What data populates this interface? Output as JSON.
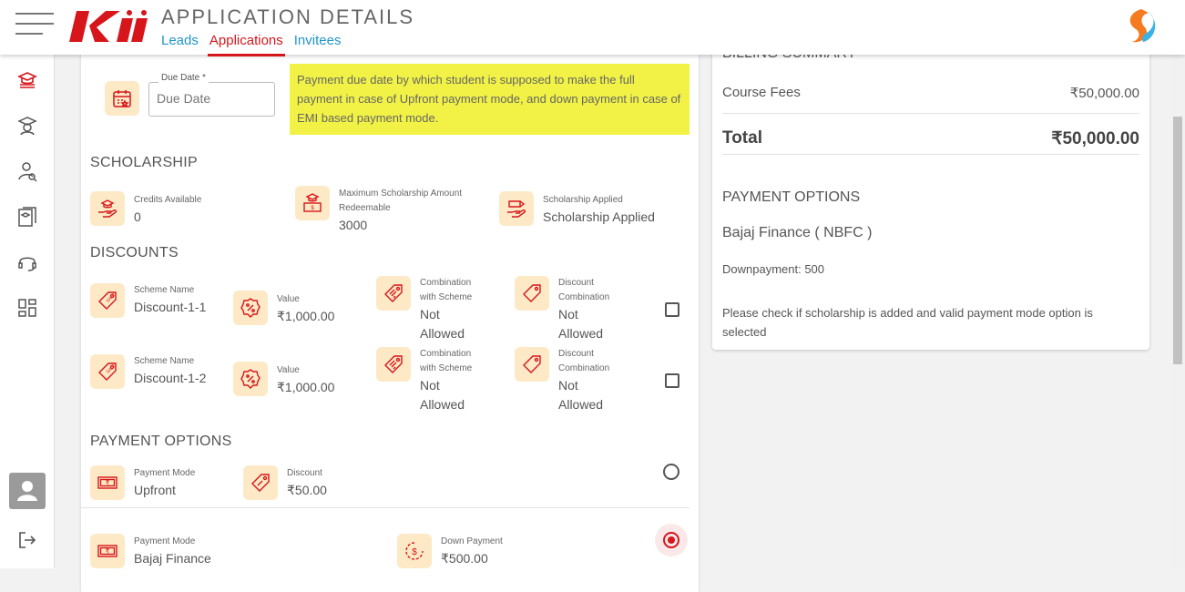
{
  "header": {
    "title": "APPLICATION DETAILS",
    "tabs": [
      {
        "label": "Leads",
        "active": false
      },
      {
        "label": "Applications",
        "active": true
      },
      {
        "label": "Invitees",
        "active": false
      }
    ],
    "logo_text": "Kii"
  },
  "sidebar": {
    "icons": [
      "graduation-stack-icon",
      "graduation-cap-user-icon",
      "user-search-icon",
      "courses-icon",
      "headset-icon",
      "dashboard-grid-icon"
    ],
    "bottom": [
      "avatar",
      "logout-icon"
    ]
  },
  "due_date": {
    "label": "Due Date *",
    "placeholder": "Due Date",
    "note": "Payment due date by which student is supposed to make the full payment in case of Upfront payment mode, and down payment in case of EMI based payment mode."
  },
  "scholarship": {
    "title": "SCHOLARSHIP",
    "items": [
      {
        "label": "Credits Available",
        "value": "0"
      },
      {
        "label": "Maximum Scholarship Amount Redeemable",
        "value": "3000"
      },
      {
        "label": "Scholarship Applied",
        "value": "Scholarship Applied"
      }
    ]
  },
  "discounts": {
    "title": "DISCOUNTS",
    "rows": [
      {
        "scheme_label": "Scheme Name",
        "scheme": "Discount-1-1",
        "value_label": "Value",
        "value": "₹1,000.00",
        "combo_scheme_label": "Combination with Scheme",
        "combo_scheme": "Not Allowed",
        "combo_discount_label": "Discount Combination",
        "combo_discount": "Not Allowed",
        "checked": false
      },
      {
        "scheme_label": "Scheme Name",
        "scheme": "Discount-1-2",
        "value_label": "Value",
        "value": "₹1,000.00",
        "combo_scheme_label": "Combination with Scheme",
        "combo_scheme": "Not Allowed",
        "combo_discount_label": "Discount Combination",
        "combo_discount": "Not Allowed",
        "checked": false
      }
    ]
  },
  "payment_options": {
    "title": "PAYMENT OPTIONS",
    "options": [
      {
        "mode_label": "Payment Mode",
        "mode": "Upfront",
        "extra_label": "Discount",
        "extra": "₹50.00",
        "selected": false
      },
      {
        "mode_label": "Payment Mode",
        "mode": "Bajaj Finance",
        "extra_label": "Down Payment",
        "extra": "₹500.00",
        "selected": true
      }
    ]
  },
  "billing": {
    "title": "BILLING SUMMARY",
    "course_fees_label": "Course Fees",
    "course_fees": "₹50,000.00",
    "total_label": "Total",
    "total": "₹50,000.00",
    "payment_title": "PAYMENT OPTIONS",
    "provider": "Bajaj Finance ( NBFC )",
    "downpayment": "Downpayment: 500",
    "notice": "Please check if scholarship is added and valid payment mode option is selected"
  },
  "colors": {
    "accent": "#d6161b",
    "link": "#2196c9",
    "icon_bg": "#fde9c6",
    "note_bg": "#f1f245"
  }
}
